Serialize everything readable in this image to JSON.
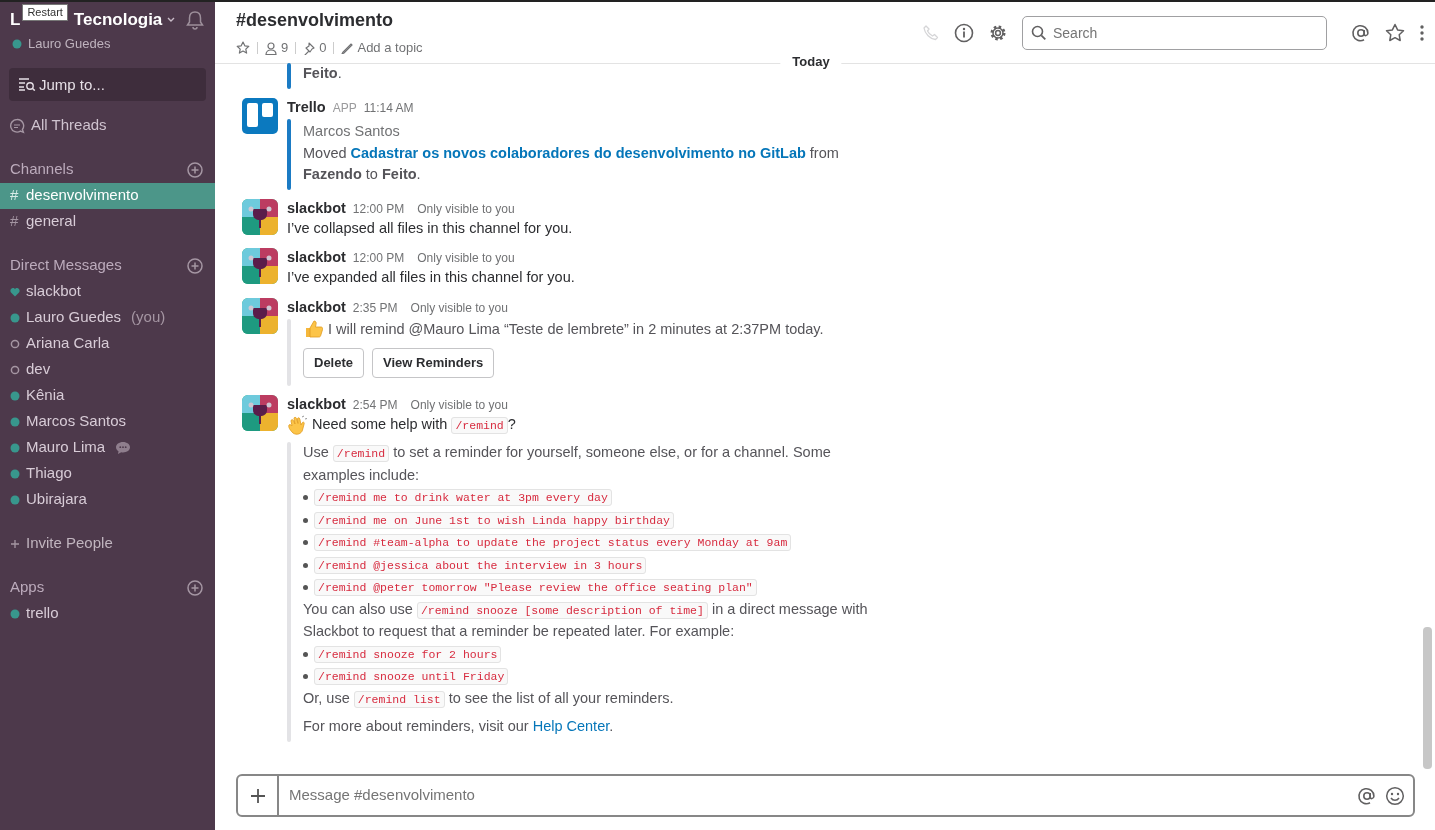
{
  "workspace": {
    "name_parts": [
      "L",
      "Tecnologia"
    ],
    "user": "Lauro Guedes",
    "user_online": true,
    "tooltip": "Restart"
  },
  "jump": {
    "placeholder": "Jump to..."
  },
  "all_threads": "All Threads",
  "sections": [
    {
      "title": "Channels",
      "add": true,
      "items": [
        {
          "kind": "channel",
          "prefix": "#",
          "label": "desenvolvimento",
          "selected": true
        },
        {
          "kind": "channel",
          "prefix": "#",
          "label": "general",
          "selected": false
        }
      ]
    },
    {
      "title": "Direct Messages",
      "add": true,
      "items": [
        {
          "kind": "bot",
          "label": "slackbot",
          "selected": false
        },
        {
          "kind": "dm",
          "online": true,
          "label": "Lauro Guedes",
          "suffix": "(you)",
          "selected": false
        },
        {
          "kind": "dm",
          "online": false,
          "label": "Ariana Carla",
          "selected": false
        },
        {
          "kind": "dm",
          "online": false,
          "label": "dev",
          "selected": false
        },
        {
          "kind": "dm",
          "online": true,
          "label": "Kênia",
          "selected": false
        },
        {
          "kind": "dm",
          "online": true,
          "label": "Marcos Santos",
          "selected": false
        },
        {
          "kind": "dm",
          "online": true,
          "label": "Mauro Lima",
          "typing": true,
          "selected": false
        },
        {
          "kind": "dm",
          "online": true,
          "label": "Thiago",
          "selected": false
        },
        {
          "kind": "dm",
          "online": true,
          "label": "Ubirajara",
          "selected": false
        }
      ]
    },
    {
      "kind": "invite",
      "label": "Invite People"
    },
    {
      "title": "Apps",
      "add": true,
      "items": [
        {
          "kind": "dm",
          "online": true,
          "label": "trello",
          "selected": false
        }
      ]
    }
  ],
  "header": {
    "title": "#desenvolvimento",
    "members": "9",
    "pins": "0",
    "topic": "Add a topic",
    "call_disabled": true,
    "search_placeholder": "Search"
  },
  "divider": "Today",
  "messages": [
    {
      "kind": "fragment",
      "attachment": {
        "color": "#1b7bc4",
        "paragraphs": [
          {
            "segments": [
              {
                "kind": "text",
                "text": "**Feito**."
              }
            ]
          }
        ]
      }
    },
    {
      "kind": "app",
      "author": "Trello",
      "badge": "APP",
      "time": "11:14 AM",
      "attachment": {
        "color": "#1b7bc4",
        "title": "Marcos Santos",
        "paragraphs": [
          {
            "segments": [
              {
                "kind": "text",
                "text": "Moved "
              },
              {
                "kind": "link",
                "bold": true,
                "text": "Cadastrar os novos colaboradores do desenvolvimento no GitLab"
              },
              {
                "kind": "text",
                "text": " from **Fazendo** to **Feito**."
              }
            ]
          }
        ]
      }
    },
    {
      "kind": "bot",
      "author": "slackbot",
      "time": "12:00 PM",
      "note": "Only visible to you",
      "paragraphs": [
        {
          "segments": [
            {
              "kind": "text",
              "text": "I’ve collapsed all files in this channel for you."
            }
          ]
        }
      ]
    },
    {
      "kind": "bot",
      "author": "slackbot",
      "time": "12:00 PM",
      "note": "Only visible to you",
      "paragraphs": [
        {
          "segments": [
            {
              "kind": "text",
              "text": "I’ve expanded all files in this channel for you."
            }
          ]
        }
      ]
    },
    {
      "kind": "bot",
      "author": "slackbot",
      "time": "2:35 PM",
      "note": "Only visible to you",
      "attachment": {
        "color": "#e3e3e6",
        "paragraphs": [
          {
            "kind": "thumbs",
            "segments": [
              {
                "kind": "text",
                "text": "I will remind @Mauro Lima “Teste de lembrete” in 2 minutes at 2:37PM today."
              }
            ]
          }
        ],
        "buttons": [
          "Delete",
          "View Reminders"
        ]
      }
    },
    {
      "kind": "bot",
      "author": "slackbot",
      "time": "2:54 PM",
      "note": "Only visible to you",
      "paragraphs": [
        {
          "kind": "wave",
          "segments": [
            {
              "kind": "text",
              "text": "Need some help with "
            },
            {
              "kind": "code",
              "text": "/remind"
            },
            {
              "kind": "text",
              "text": "?"
            }
          ]
        }
      ],
      "attachment": {
        "color": "#e3e3e6",
        "paragraphs": [
          {
            "segments": [
              {
                "kind": "text",
                "text": "Use "
              },
              {
                "kind": "code",
                "text": "/remind"
              },
              {
                "kind": "text",
                "text": " to set a reminder for yourself, someone else, or for a channel. Some examples include:"
              }
            ]
          },
          {
            "kind": "bullet",
            "segments": [
              {
                "kind": "code",
                "text": "/remind me to drink water at 3pm every day"
              }
            ]
          },
          {
            "kind": "bullet",
            "segments": [
              {
                "kind": "code",
                "text": "/remind me on June 1st to wish Linda happy birthday"
              }
            ]
          },
          {
            "kind": "bullet",
            "segments": [
              {
                "kind": "code",
                "text": "/remind #team-alpha to update the project status every Monday at 9am"
              }
            ]
          },
          {
            "kind": "bullet",
            "segments": [
              {
                "kind": "code",
                "text": "/remind @jessica about the interview in 3 hours"
              }
            ]
          },
          {
            "kind": "bullet",
            "segments": [
              {
                "kind": "code",
                "text": "/remind @peter tomorrow \"Please review the office seating plan\""
              }
            ]
          },
          {
            "segments": [
              {
                "kind": "text",
                "text": "You can also use "
              },
              {
                "kind": "code",
                "text": "/remind snooze [some description of time]"
              },
              {
                "kind": "text",
                "text": " in a direct message with Slackbot to request that a reminder be repeated later. For example:"
              }
            ]
          },
          {
            "kind": "bullet",
            "segments": [
              {
                "kind": "code",
                "text": "/remind snooze for 2 hours"
              }
            ]
          },
          {
            "kind": "bullet",
            "segments": [
              {
                "kind": "code",
                "text": "/remind snooze until Friday"
              }
            ]
          },
          {
            "segments": [
              {
                "kind": "text",
                "text": "Or, use "
              },
              {
                "kind": "code",
                "text": "/remind list"
              },
              {
                "kind": "text",
                "text": " to see the list of all your reminders."
              }
            ]
          },
          {
            "kind": "spaced",
            "segments": [
              {
                "kind": "text",
                "text": "For more about reminders, visit our "
              },
              {
                "kind": "link",
                "bold": false,
                "text": "Help Center"
              },
              {
                "kind": "text",
                "text": "."
              }
            ]
          }
        ]
      }
    }
  ],
  "composer": {
    "placeholder": "Message #desenvolvimento"
  }
}
